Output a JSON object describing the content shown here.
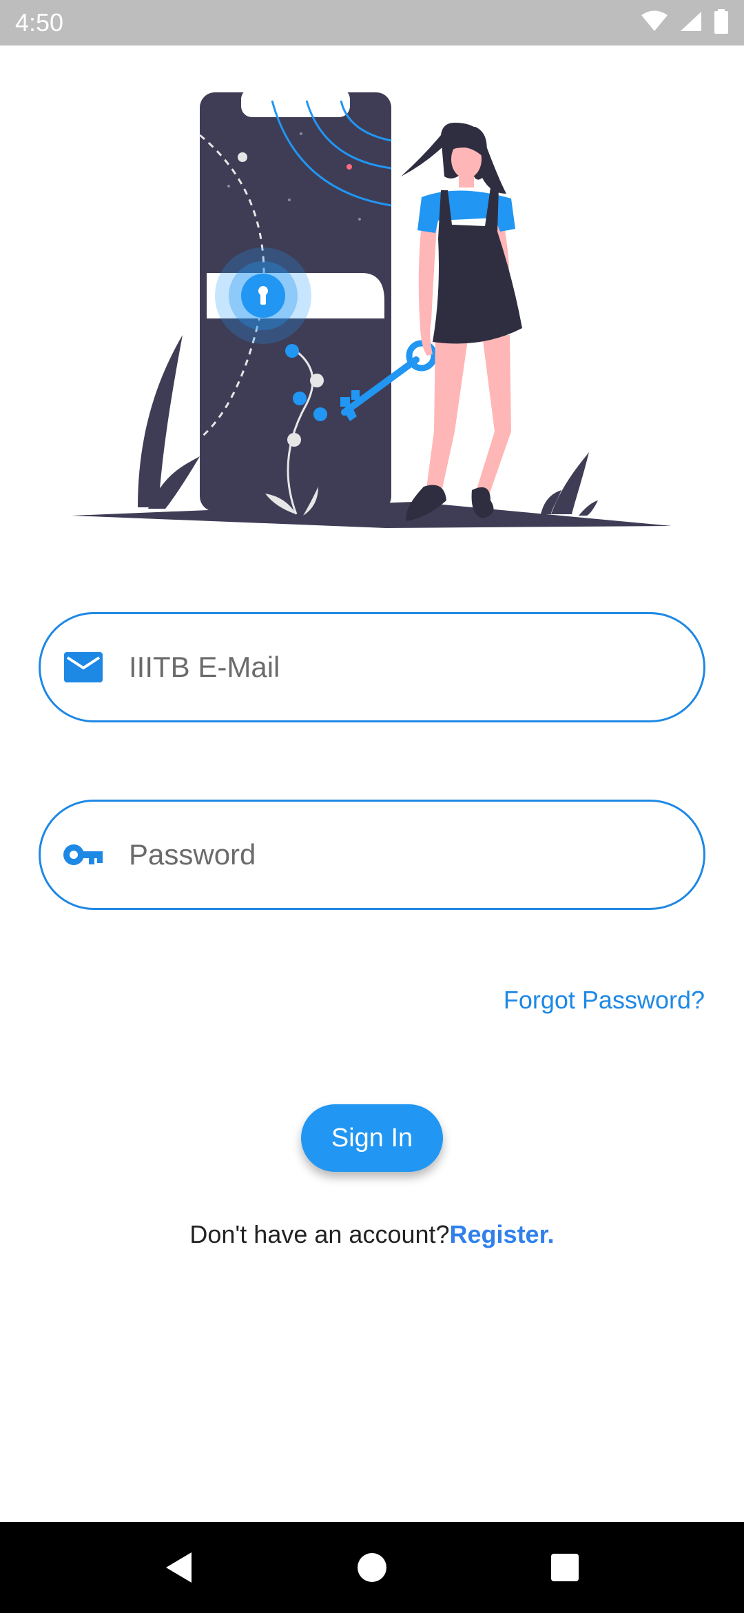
{
  "status_bar": {
    "time": "4:50",
    "icons": [
      "wifi-icon",
      "signal-icon",
      "battery-icon"
    ]
  },
  "illustration": {
    "name": "phone-unlock-illustration"
  },
  "form": {
    "email": {
      "placeholder": "IIITB E-Mail",
      "value": "",
      "icon": "mail-icon"
    },
    "password": {
      "placeholder": "Password",
      "value": "",
      "icon": "key-icon"
    },
    "forgot_password": "Forgot Password?",
    "sign_in": "Sign In",
    "register_prompt": "Don't have an account?",
    "register_link": "Register."
  },
  "nav_bar": {
    "buttons": [
      "back-icon",
      "home-icon",
      "recents-icon"
    ]
  },
  "colors": {
    "accent": "#2196f3",
    "field_border": "#1e88e5",
    "link": "#2f80ed",
    "illustration_dark": "#3f3d56",
    "skin": "#ffb6b6"
  }
}
